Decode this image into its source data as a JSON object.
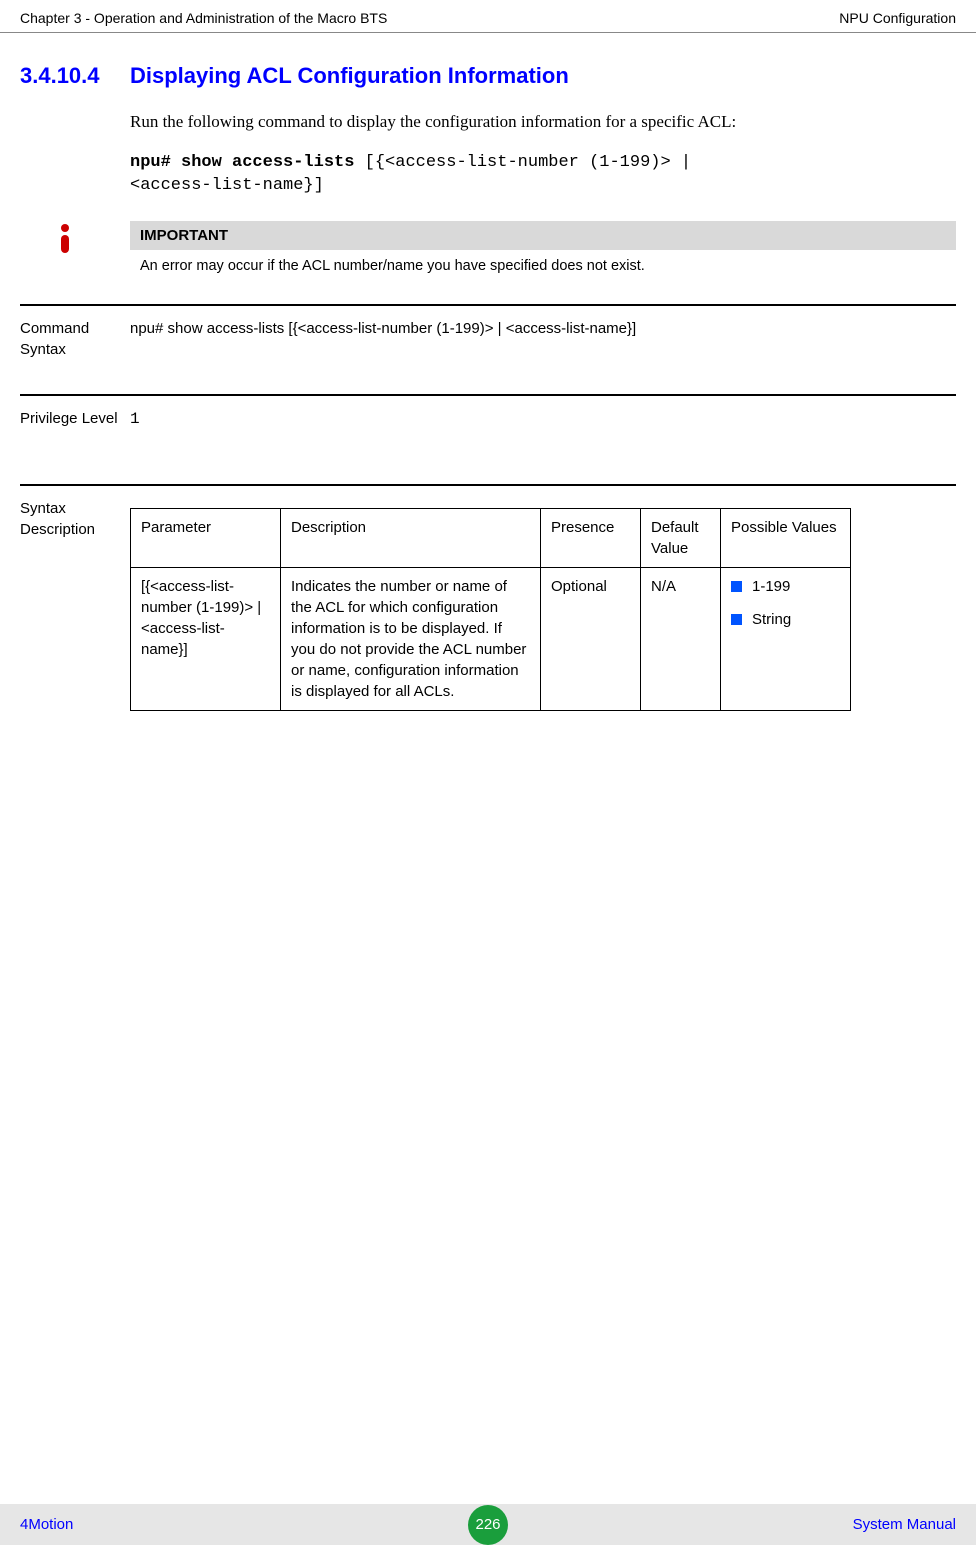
{
  "header": {
    "left": "Chapter 3 - Operation and Administration of the Macro BTS",
    "right": "NPU Configuration"
  },
  "section": {
    "number": "3.4.10.4",
    "title": "Displaying ACL Configuration Information"
  },
  "intro": "Run the following command to display the configuration information for a specific ACL:",
  "code": {
    "bold": "npu# show access-lists ",
    "rest1": "[{<access-list-number (1-199)> |",
    "rest2": "<access-list-name}]"
  },
  "important": {
    "label": "IMPORTANT",
    "text": "An error may occur if the ACL number/name you have specified does not exist."
  },
  "rows": {
    "command_syntax": {
      "label": "Command Syntax",
      "value": "npu# show access-lists [{<access-list-number (1-199)> | <access-list-name}]"
    },
    "privilege_level": {
      "label": "Privilege Level",
      "value": "1"
    },
    "syntax_desc": {
      "label": "Syntax Description"
    }
  },
  "table": {
    "headers": {
      "parameter": "Parameter",
      "description": "Description",
      "presence": "Presence",
      "default": "Default Value",
      "possible": "Possible Values"
    },
    "row": {
      "parameter": "[{<access-list-number (1-199)> | <access-list-name}]",
      "description": "Indicates the number or name of the ACL for which configuration information is to be displayed. If you do not provide the ACL number or name, configuration information is displayed for all ACLs.",
      "presence": "Optional",
      "default": "N/A",
      "possible": [
        "1-199",
        "String"
      ]
    }
  },
  "footer": {
    "left": "4Motion",
    "page": "226",
    "right": "System Manual"
  }
}
